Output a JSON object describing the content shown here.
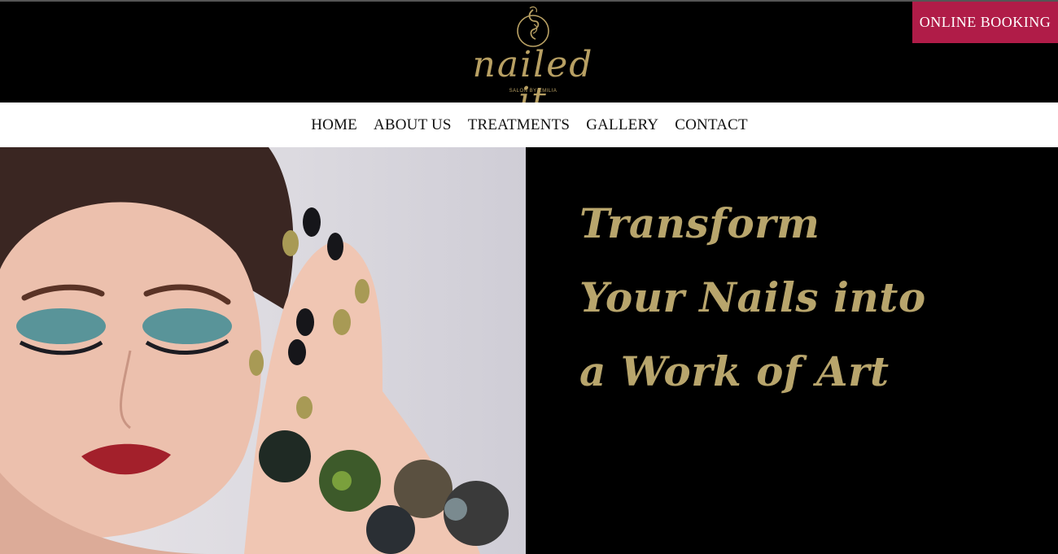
{
  "header": {
    "logo_text": "nailed it",
    "logo_subtitle": "SALON BY EMILIA",
    "booking_label": "ONLINE BOOKING"
  },
  "nav": {
    "items": [
      {
        "label": "HOME"
      },
      {
        "label": "ABOUT US"
      },
      {
        "label": "TREATMENTS"
      },
      {
        "label": "GALLERY"
      },
      {
        "label": "CONTACT"
      }
    ]
  },
  "hero": {
    "tagline_lines": [
      "Transform",
      "Your Nails into",
      "a Work of Art"
    ]
  },
  "colors": {
    "gold": "#b8a56c",
    "booking_bg": "#b01c48",
    "header_bg": "#000000",
    "nav_bg": "#ffffff"
  }
}
